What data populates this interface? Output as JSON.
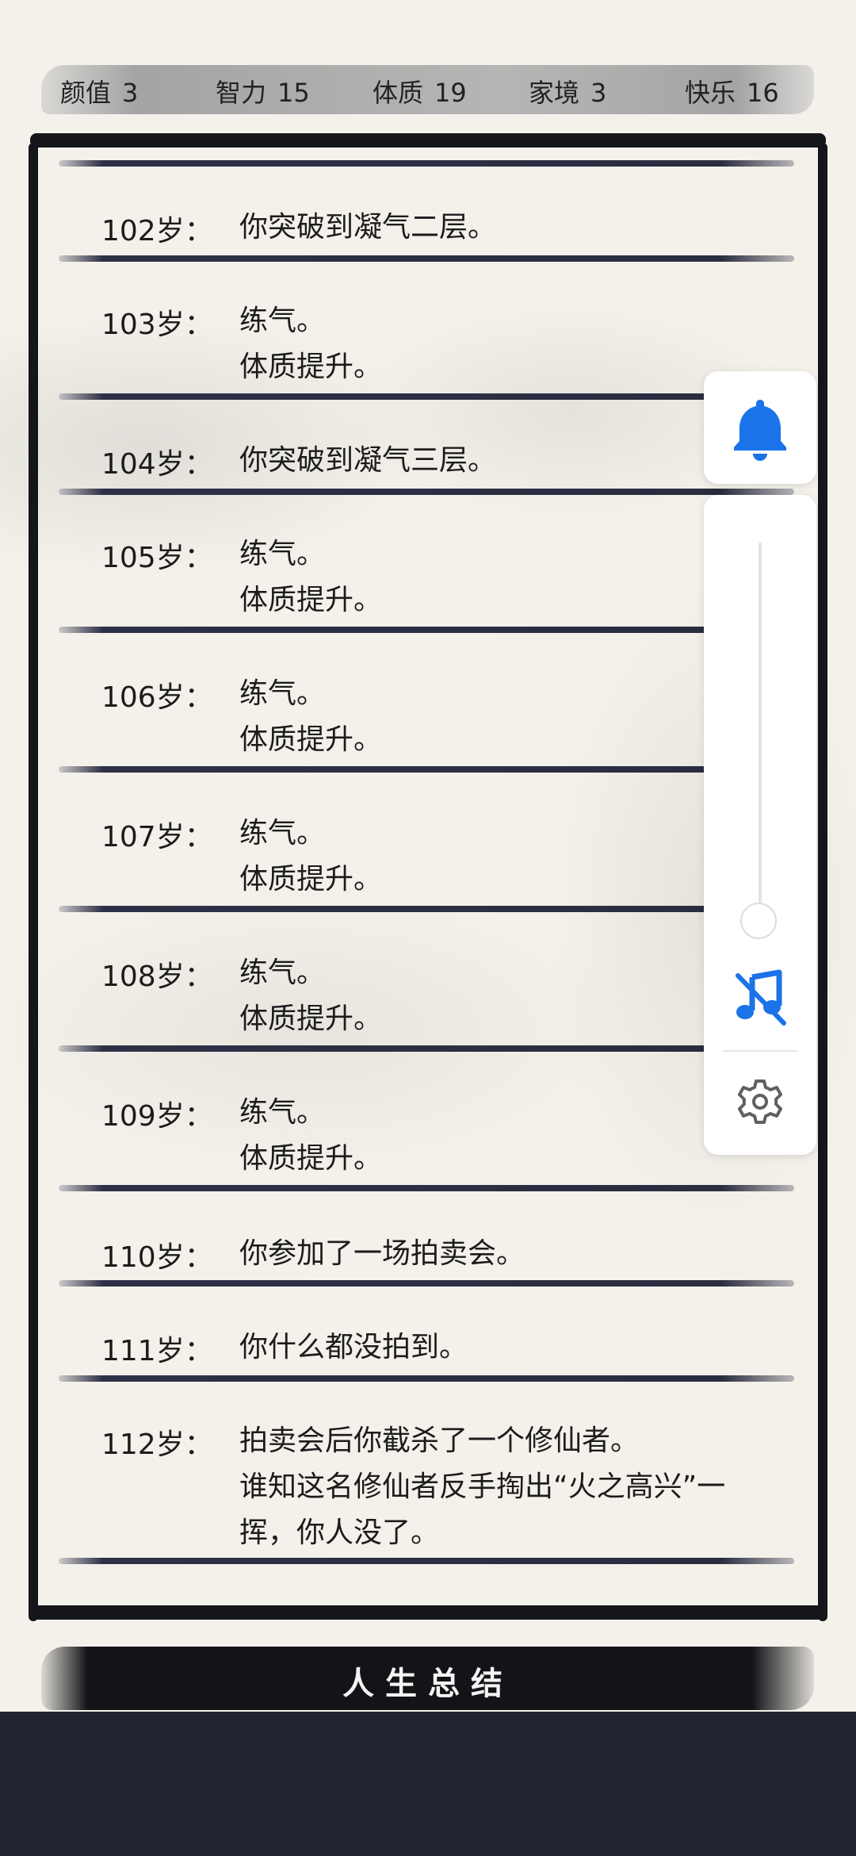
{
  "stats": [
    {
      "label": "颜值",
      "value": "3"
    },
    {
      "label": "智力",
      "value": "15"
    },
    {
      "label": "体质",
      "value": "19"
    },
    {
      "label": "家境",
      "value": "3"
    },
    {
      "label": "快乐",
      "value": "16"
    }
  ],
  "events": [
    {
      "age": "102岁：",
      "lines": [
        "你突破到凝气二层。"
      ]
    },
    {
      "age": "103岁：",
      "lines": [
        "练气。",
        "体质提升。"
      ]
    },
    {
      "age": "104岁：",
      "lines": [
        "你突破到凝气三层。"
      ]
    },
    {
      "age": "105岁：",
      "lines": [
        "练气。",
        "体质提升。"
      ]
    },
    {
      "age": "106岁：",
      "lines": [
        "练气。",
        "体质提升。"
      ]
    },
    {
      "age": "107岁：",
      "lines": [
        "练气。",
        "体质提升。"
      ]
    },
    {
      "age": "108岁：",
      "lines": [
        "练气。",
        "体质提升。"
      ]
    },
    {
      "age": "109岁：",
      "lines": [
        "练气。",
        "体质提升。"
      ]
    },
    {
      "age": "110岁：",
      "lines": [
        "你参加了一场拍卖会。"
      ]
    },
    {
      "age": "111岁：",
      "lines": [
        "你什么都没拍到。"
      ]
    },
    {
      "age": "112岁：",
      "lines": [
        "拍卖会后你截杀了一个修仙者。",
        "谁知这名修仙者反手掏出“火之高兴”一",
        "挥，你人没了。"
      ]
    }
  ],
  "summary_button": "人生总结",
  "volume_panel": {
    "level": 0,
    "icons": {
      "bell": "bell-icon",
      "music": "music-off-icon",
      "settings": "gear-icon"
    }
  },
  "colors": {
    "accent": "#1a73e8",
    "ink": "#15161b",
    "paper": "#f4f1ea",
    "nav": "#1f2430"
  }
}
